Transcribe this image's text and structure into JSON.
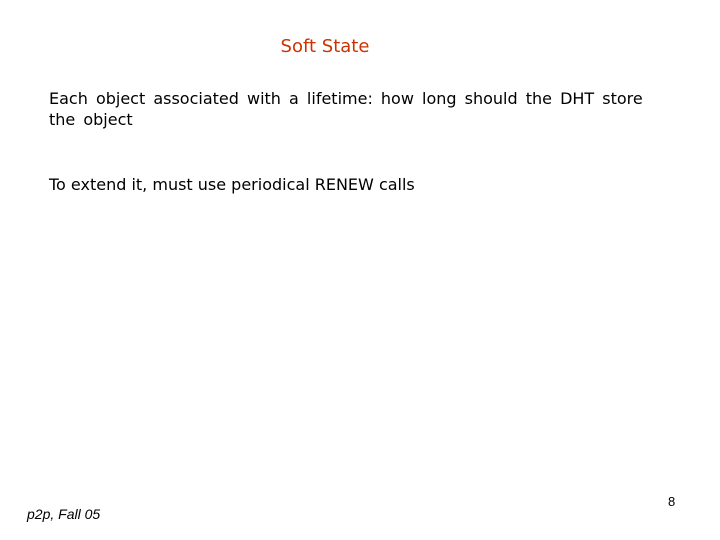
{
  "slide": {
    "title": "Soft State",
    "paragraphs": [
      "Each object associated with a lifetime: how long should the DHT store the object",
      "To extend it, must use periodical RENEW calls"
    ],
    "footer": "p2p, Fall 05",
    "page_number": "8",
    "title_color": "#cc3300"
  }
}
